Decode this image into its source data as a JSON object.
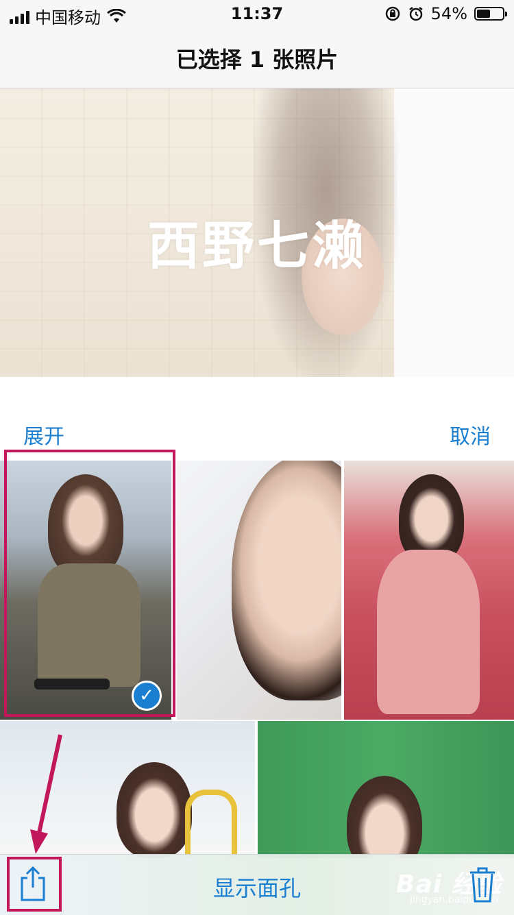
{
  "status_bar": {
    "carrier": "中国移动",
    "time": "11:37",
    "battery": "54%",
    "battery_level": 0.54,
    "icons": [
      "signal-icon",
      "wifi-icon",
      "rotation-lock-icon",
      "alarm-icon",
      "battery-icon"
    ]
  },
  "nav": {
    "title": "已选择 1 张照片"
  },
  "hero": {
    "title": "西野七濑",
    "play_icon": "play-icon"
  },
  "actions": {
    "expand_label": "展开",
    "cancel_label": "取消"
  },
  "grid": {
    "photos": [
      {
        "selected": true
      },
      {
        "selected": false
      },
      {
        "selected": false
      },
      {
        "selected": false
      },
      {
        "selected": false
      }
    ],
    "check_glyph": "✓"
  },
  "toolbar": {
    "title": "显示面孔",
    "share_icon": "share-icon",
    "trash_icon": "trash-icon",
    "watermark": "Bai 经验",
    "watermark_sub": "jingyan.baidu.com"
  },
  "colors": {
    "accent": "#1a7fd0",
    "annotation": "#c2185b"
  }
}
